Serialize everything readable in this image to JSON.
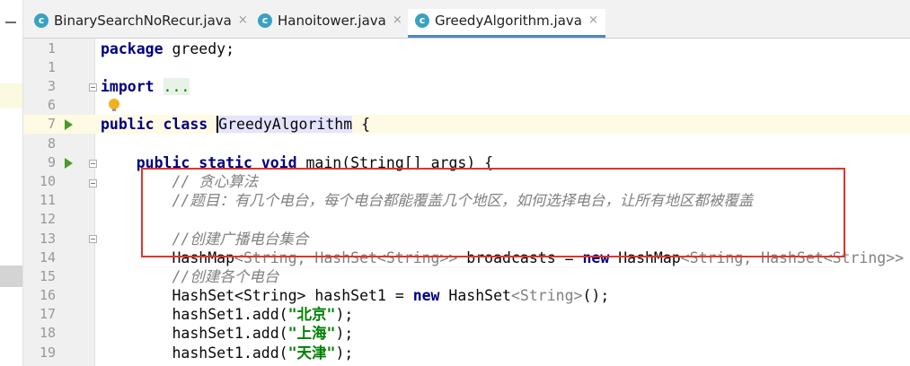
{
  "tabs": [
    {
      "label": "BinarySearchNoRecur.java",
      "icon": "java-class-icon",
      "active": false
    },
    {
      "label": "Hanoitower.java",
      "icon": "java-class-icon",
      "active": false
    },
    {
      "label": "GreedyAlgorithm.java",
      "icon": "java-class-icon",
      "active": true
    }
  ],
  "tab_icon_glyph": "c",
  "close_glyph": "×",
  "lines": [
    {
      "num": "1",
      "code": [
        "package",
        " greedy;"
      ]
    },
    {
      "num": "1",
      "code": []
    },
    {
      "num": "3",
      "code": [
        "import",
        " ",
        "..."
      ]
    },
    {
      "num": "6",
      "code": []
    },
    {
      "num": "7",
      "code": [
        "public class",
        " ",
        "GreedyAlgorithm",
        " {"
      ]
    },
    {
      "num": "8",
      "code": []
    },
    {
      "num": "9",
      "code": [
        "    ",
        "public static void",
        " main(String[] args) {"
      ]
    },
    {
      "num": "10",
      "code": [
        "        // 贪心算法"
      ]
    },
    {
      "num": "11",
      "code": [
        "        //题目：有几个电台，每个电台都能覆盖几个地区，如何选择电台，让所有地区都被覆盖"
      ]
    },
    {
      "num": "12",
      "code": []
    },
    {
      "num": "13",
      "code": [
        "        //创建广播电台集合"
      ]
    },
    {
      "num": "14",
      "code": [
        "        HashMap",
        "<String, HashSet<String>>",
        " broadcasts = ",
        "new",
        " HashMap",
        "<String, HashSet<String>>"
      ]
    },
    {
      "num": "15",
      "code": [
        "        //创建各个电台"
      ]
    },
    {
      "num": "16",
      "code": [
        "        HashSet<String> hashSet1 = ",
        "new",
        " HashSet",
        "<String>",
        "();"
      ]
    },
    {
      "num": "17",
      "code": [
        "        hashSet1.add(",
        "\"北京\"",
        ");"
      ]
    },
    {
      "num": "18",
      "code": [
        "        hashSet1.add(",
        "\"上海\"",
        ");"
      ]
    },
    {
      "num": "19",
      "code": [
        "        hashSet1.add(",
        "\"天津\"",
        ");"
      ]
    }
  ],
  "colors": {
    "keyword": "#000080",
    "comment": "#808080",
    "string": "#008000",
    "annotation_box": "#e0342a",
    "tab_underline": "#4a88c7"
  }
}
